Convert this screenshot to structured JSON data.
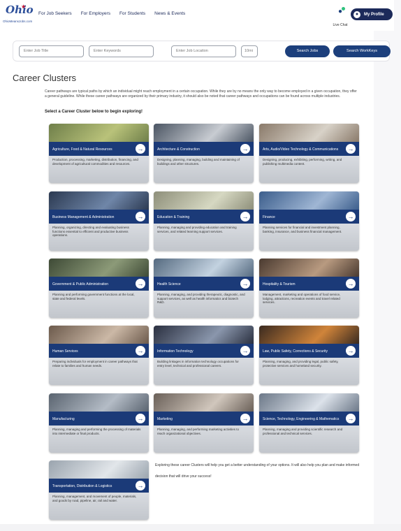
{
  "header": {
    "logo": {
      "mark": "Ohio",
      "sub": "OhioMeansJobs.com"
    },
    "nav": [
      "For Job Seekers",
      "For Employers",
      "For Students",
      "News & Events"
    ],
    "chat_label": "Live Chat",
    "profile_label": "My Profile"
  },
  "search": {
    "job_title_placeholder": "Enter Job Title",
    "keywords_placeholder": "Enter Keywords",
    "in_label": "in",
    "location_placeholder": "Enter Job Location",
    "radius_value": "10mi",
    "search_jobs_label": "Search Jobs",
    "search_workkeys_label": "Search WorkKeys"
  },
  "page": {
    "title": "Career Clusters",
    "intro": "Career pathways are typical paths by which an individual might reach employment in a certain occupation. While they are by no means the only way to become employed in a given occupation, they offer a general guideline. While these career pathways are organized by their primary industry, it should also be noted that career pathways and occupations can be found across multiple industries.",
    "lead": "Select a Career Cluster below to begin exploring!",
    "outro": "Exploring these career Clusters will help you get a better understanding of your options. It will also help you plan and make informed decision that will drive your success!"
  },
  "clusters": [
    {
      "name": "Agriculture, Food & Natural Resources",
      "desc": "Production, processing, marketing, distribution, financing, and development of agricultural commodities and resources.",
      "photo": [
        "#6f7f4a",
        "#b9c27a"
      ]
    },
    {
      "name": "Architecture & Construction",
      "desc": "Designing, planning, managing, building and maintaining of buildings and other structures.",
      "photo": [
        "#4b5563",
        "#c8ccd2"
      ]
    },
    {
      "name": "Arts, Audio/Video Technology & Communications",
      "desc": "Designing, producing, exhibiting, performing, writing, and publishing multimedia content.",
      "photo": [
        "#8a7a6a",
        "#d8d2c8"
      ]
    },
    {
      "name": "Business Management & Administration",
      "desc": "Planning, organizing, directing and evaluating business functions essential to efficient and productive business operations.",
      "photo": [
        "#2c3a52",
        "#6f86a8"
      ]
    },
    {
      "name": "Education & Training",
      "desc": "Planning, managing and providing education and training services, and related learning support services.",
      "photo": [
        "#8e8f7a",
        "#d6d8c2"
      ]
    },
    {
      "name": "Finance",
      "desc": "Planning services for financial and investment planning, banking, insurance, and business financial management.",
      "photo": [
        "#3c5e8c",
        "#9fb6d4"
      ]
    },
    {
      "name": "Government & Public Administration",
      "desc": "Planning and performing government functions at the local, state and federal levels.",
      "photo": [
        "#3e4a36",
        "#8c9a78"
      ]
    },
    {
      "name": "Health Science",
      "desc": "Planning, managing, and providing therapeutic, diagnostic, and support services, as well as health informatics and biotech R&D.",
      "photo": [
        "#556a80",
        "#c3d2e0"
      ]
    },
    {
      "name": "Hospitality & Tourism",
      "desc": "Management, marketing and operations of food service, lodging, attractions, recreation events and travel related services.",
      "photo": [
        "#4a3a30",
        "#b89a80"
      ]
    },
    {
      "name": "Human Services",
      "desc": "Preparing individuals for employment in career pathways that relate to families and human needs.",
      "photo": [
        "#6c5a4c",
        "#cbb8a6"
      ]
    },
    {
      "name": "Information Technology",
      "desc": "Building linkages in information technology occupations for entry level, technical and professional careers.",
      "photo": [
        "#2a3040",
        "#8a96ac"
      ]
    },
    {
      "name": "Law, Public Safety, Corrections & Security",
      "desc": "Planning, managing, and providing legal, public safety, protective services and homeland security.",
      "photo": [
        "#3a2a20",
        "#d0843a"
      ]
    },
    {
      "name": "Manufacturing",
      "desc": "Planning, managing and performing the processing of materials into intermediate or final products.",
      "photo": [
        "#5a6470",
        "#b4bcc6"
      ]
    },
    {
      "name": "Marketing",
      "desc": "Planning, managing, and performing marketing activities to reach organizational objectives.",
      "photo": [
        "#6a6058",
        "#d0c6bc"
      ]
    },
    {
      "name": "Science, Technology, Engineering & Mathematics",
      "desc": "Planning, managing and providing scientific research and professional and technical services.",
      "photo": [
        "#6c7888",
        "#dce2ea"
      ]
    },
    {
      "name": "Transportation, Distribution & Logistics",
      "desc": "Planning, management, and movement of people, materials, and goods by road, pipeline, air, rail and water.",
      "photo": [
        "#9aa4ae",
        "#e2e6ea"
      ]
    }
  ]
}
